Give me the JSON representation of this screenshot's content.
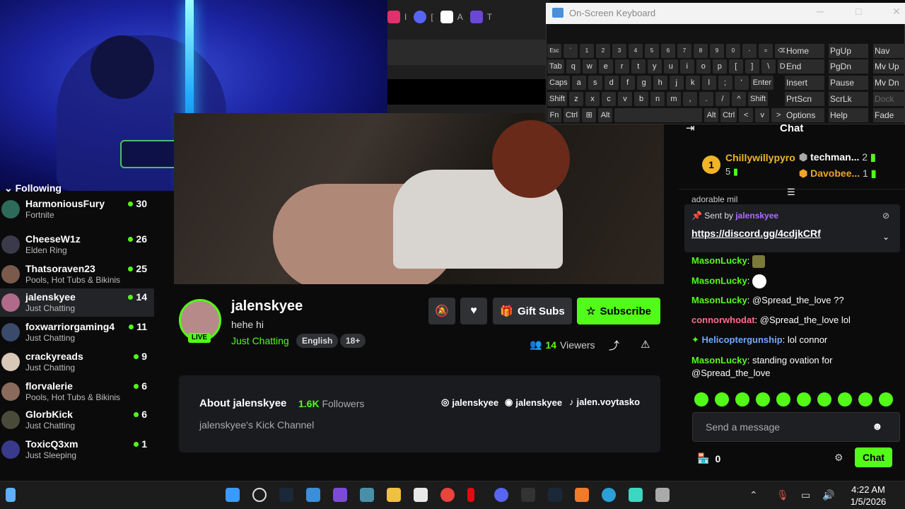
{
  "browser": {
    "tabs": [
      {
        "label": "I",
        "icon": "instagram-icon",
        "color": "#e1306c"
      },
      {
        "label": "[",
        "icon": "discord-icon",
        "color": "#5865f2"
      },
      {
        "label": "A",
        "icon": "amazon-icon",
        "color": "#ffffff"
      },
      {
        "label": "T",
        "icon": "app-icon",
        "color": "#6b47d8"
      }
    ]
  },
  "following": {
    "title": "Following",
    "items": [
      {
        "name": "HarmoniousFury",
        "game": "Fortnite",
        "count": "30"
      },
      {
        "name": "CheeseW1z",
        "game": "Elden Ring",
        "count": "26"
      },
      {
        "name": "Thatsoraven23",
        "game": "Pools, Hot Tubs & Bikinis",
        "count": "25"
      },
      {
        "name": "jalenskyee",
        "game": "Just Chatting",
        "count": "14"
      },
      {
        "name": "foxwarriorgaming4",
        "game": "Just Chatting",
        "count": "11"
      },
      {
        "name": "crackyreads",
        "game": "Just Chatting",
        "count": "9"
      },
      {
        "name": "florvalerie",
        "game": "Pools, Hot Tubs & Bikinis",
        "count": "6"
      },
      {
        "name": "GlorbKick",
        "game": "Just Chatting",
        "count": "6"
      },
      {
        "name": "ToxicQ3xm",
        "game": "Just Sleeping",
        "count": "1"
      }
    ]
  },
  "channel": {
    "name": "jalenskyee",
    "live": "LIVE",
    "title": "hehe hi",
    "category": "Just Chatting",
    "tags": [
      "English",
      "18+"
    ],
    "gift_label": "Gift Subs",
    "subscribe_label": "Subscribe",
    "viewers_count": "14",
    "viewers_label": "Viewers"
  },
  "about": {
    "title": "About jalenskyee",
    "followers_count": "1.6K",
    "followers_label": "Followers",
    "description": "jalenskyee's Kick Channel",
    "socials": [
      {
        "icon": "instagram-icon",
        "handle": "jalenskyee"
      },
      {
        "icon": "discord-icon",
        "handle": "jalenskyee"
      },
      {
        "icon": "tiktok-icon",
        "handle": "jalen.voytasko"
      }
    ]
  },
  "chat": {
    "title": "Chat",
    "leaderboard": {
      "top": {
        "rank": "1",
        "name": "Chillywillypyro",
        "count": "5"
      },
      "others": [
        {
          "name": "techman...",
          "count": "2"
        },
        {
          "name": "Davobee...",
          "count": "1"
        }
      ]
    },
    "partial_msg": "adorable mil",
    "pinned": {
      "sent_by_label": "Sent by",
      "user": "jalenskyee",
      "link": "https://discord.gg/4cdjkCRf"
    },
    "messages": [
      {
        "user": "MasonLucky",
        "text": "",
        "color": "#53fc18"
      },
      {
        "user": "MasonLucky",
        "text": "",
        "color": "#53fc18"
      },
      {
        "user": "MasonLucky",
        "text": "@Spread_the_love ??",
        "color": "#53fc18"
      },
      {
        "user": "connorwhodat",
        "text": "@Spread_the_love lol",
        "color": "#ff6b8a"
      },
      {
        "user": "Helicoptergunship",
        "text": "lol connor",
        "color": "#6fa8ff"
      },
      {
        "user": "MasonLucky",
        "text": "standing ovation for @Spread_the_love",
        "color": "#53fc18"
      }
    ],
    "input_placeholder": "Send a message",
    "points": "0",
    "send_label": "Chat"
  },
  "osk": {
    "title": "On-Screen Keyboard",
    "rows": [
      [
        "Esc",
        "`",
        "1",
        "2",
        "3",
        "4",
        "5",
        "6",
        "7",
        "8",
        "9",
        "0",
        "-",
        "=",
        "⌫"
      ],
      [
        "Tab",
        "q",
        "w",
        "e",
        "r",
        "t",
        "y",
        "u",
        "i",
        "o",
        "p",
        "[",
        "]",
        "\\",
        "Del"
      ],
      [
        "Caps",
        "a",
        "s",
        "d",
        "f",
        "g",
        "h",
        "j",
        "k",
        "l",
        ";",
        "'",
        "Enter"
      ],
      [
        "Shift",
        "z",
        "x",
        "c",
        "v",
        "b",
        "n",
        "m",
        ",",
        ".",
        "/",
        "^",
        "Shift"
      ],
      [
        "Fn",
        "Ctrl",
        "⊞",
        "Alt",
        "",
        "Alt",
        "Ctrl",
        "<",
        "v",
        ">",
        "▤"
      ]
    ],
    "nav": [
      [
        "Home",
        "PgUp",
        "Nav"
      ],
      [
        "End",
        "PgDn",
        "Mv Up"
      ],
      [
        "Insert",
        "Pause",
        "Mv Dn"
      ],
      [
        "PrtScn",
        "ScrLk",
        "Dock"
      ],
      [
        "Options",
        "Help",
        "Fade"
      ]
    ]
  },
  "taskbar": {
    "time": "4:22 AM",
    "date": "1/5/2026"
  }
}
